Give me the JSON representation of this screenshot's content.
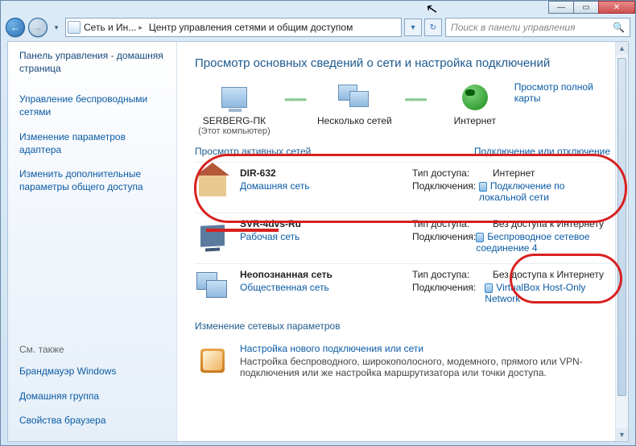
{
  "window": {
    "minimize": "—",
    "maximize": "▭",
    "close": "✕"
  },
  "nav": {
    "back": "←",
    "forward": "→",
    "dropdown": "▾"
  },
  "breadcrumb": {
    "level1": "Сеть и Ин...",
    "level2": "Центр управления сетями и общим доступом"
  },
  "addressbar": {
    "dropdown": "▾",
    "refresh": "↻"
  },
  "search": {
    "placeholder": "Поиск в панели управления",
    "icon": "🔍"
  },
  "help": {
    "label": "?"
  },
  "sidebar": {
    "title": "Панель управления - домашняя страница",
    "links": {
      "wireless": "Управление беспроводными сетями",
      "adapter": "Изменение параметров адаптера",
      "sharing": "Изменить дополнительные параметры общего доступа"
    },
    "seealso_label": "См. также",
    "seealso": {
      "firewall": "Брандмауэр Windows",
      "homegroup": "Домашняя группа",
      "browser": "Свойства браузера"
    }
  },
  "main": {
    "title": "Просмотр основных сведений о сети и настройка подключений",
    "overview": {
      "thispc": "SERBERG-ПК",
      "thispc_sub": "(Этот компьютер)",
      "multi": "Несколько сетей",
      "internet": "Интернет",
      "fullmap": "Просмотр полной карты"
    },
    "active_networks_label": "Просмотр активных сетей",
    "connect_disconnect": "Подключение или отключение",
    "labels": {
      "access_type": "Тип доступа:",
      "connections": "Подключения:"
    },
    "networks": [
      {
        "name": "DIR-632",
        "type_label": "Домашняя сеть",
        "access": "Интернет",
        "conn": "Подключение по локальной сети"
      },
      {
        "name": "SVR-4dvs-Ru",
        "type_label": "Рабочая сеть",
        "access": "Без доступа к Интернету",
        "conn": "Беспроводное сетевое соединение 4"
      },
      {
        "name": "Неопознанная сеть",
        "type_label": "Общественная сеть",
        "access": "Без доступа к Интернету",
        "conn": "VirtualBox Host-Only Network"
      }
    ],
    "change_settings_label": "Изменение сетевых параметров",
    "settings": {
      "new_conn": "Настройка нового подключения или сети",
      "new_conn_desc": "Настройка беспроводного, широкополосного, модемного, прямого или VPN-подключения или же настройка маршрутизатора или точки доступа."
    }
  }
}
